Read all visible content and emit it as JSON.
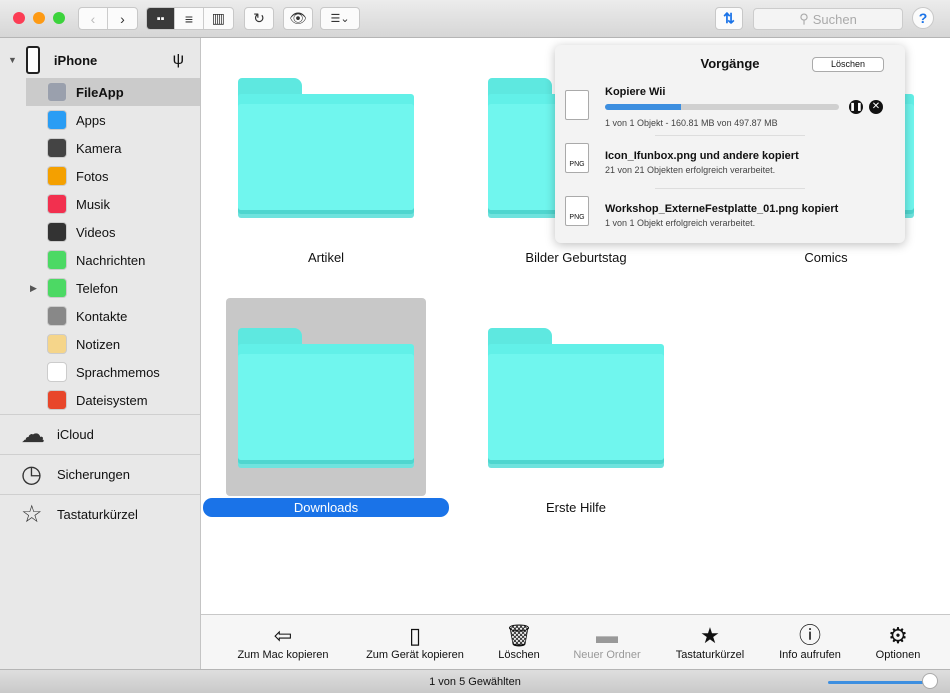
{
  "toolbar": {
    "search_placeholder": "Suchen",
    "help": "?",
    "view_modes": [
      "icon",
      "list",
      "column"
    ]
  },
  "sidebar": {
    "device": "iPhone",
    "items": [
      {
        "label": "FileApp",
        "color": "#9aa0ad",
        "selected": true
      },
      {
        "label": "Apps",
        "color": "#2a9df4"
      },
      {
        "label": "Kamera",
        "color": "#444"
      },
      {
        "label": "Fotos",
        "color": "#f4a000"
      },
      {
        "label": "Musik",
        "color": "#f2304f"
      },
      {
        "label": "Videos",
        "color": "#333"
      },
      {
        "label": "Nachrichten",
        "color": "#4cd964"
      },
      {
        "label": "Telefon",
        "color": "#4cd964",
        "expandable": true
      },
      {
        "label": "Kontakte",
        "color": "#888"
      },
      {
        "label": "Notizen",
        "color": "#f5d58a"
      },
      {
        "label": "Sprachmemos",
        "color": "#fff"
      },
      {
        "label": "Dateisystem",
        "color": "#e8462a"
      }
    ],
    "sections": [
      {
        "label": "iCloud",
        "icon": "cloud-icon"
      },
      {
        "label": "Sicherungen",
        "icon": "clock-icon"
      },
      {
        "label": "Tastaturkürzel",
        "icon": "star-icon"
      }
    ]
  },
  "folders": [
    {
      "label": "Artikel"
    },
    {
      "label": "Bilder Geburtstag"
    },
    {
      "label": "Comics"
    },
    {
      "label": "Downloads",
      "selected": true
    },
    {
      "label": "Erste Hilfe"
    }
  ],
  "popover": {
    "title": "Vorgänge",
    "clear": "Löschen",
    "current": {
      "title": "Kopiere Wii",
      "progress": 0.323,
      "detail": "1 von 1 Objekt - 160.81 MB von 497.87 MB"
    },
    "done": [
      {
        "title": "Icon_Ifunbox.png und andere kopiert",
        "detail": "21 von 21 Objekten erfolgreich verarbeitet.",
        "badge": "PNG"
      },
      {
        "title": "Workshop_ExterneFestplatte_01.png kopiert",
        "detail": "1 von 1 Objekt erfolgreich verarbeitet.",
        "badge": "PNG"
      }
    ]
  },
  "bottom": {
    "items": [
      {
        "label": "Zum Mac kopieren",
        "icon": "⇦"
      },
      {
        "label": "Zum Gerät kopieren",
        "icon": "▯"
      },
      {
        "label": "Löschen",
        "icon": "🗑"
      },
      {
        "label": "Neuer Ordner",
        "icon": "▬",
        "disabled": true
      },
      {
        "label": "Tastaturkürzel",
        "icon": "★"
      },
      {
        "label": "Info aufrufen",
        "icon": "ⓘ"
      },
      {
        "label": "Optionen",
        "icon": "⚙"
      }
    ]
  },
  "status": {
    "text": "1 von 5 Gewählten",
    "zoom": 1.0
  },
  "colors": {
    "accent": "#1a73e8",
    "folder": "#62f0e8",
    "selection": "#c8c8c8"
  }
}
